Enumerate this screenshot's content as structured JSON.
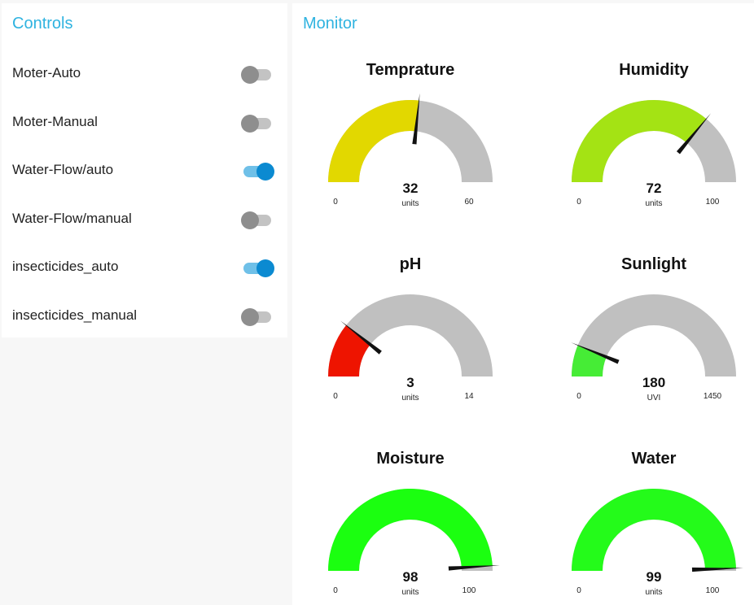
{
  "controls": {
    "title": "Controls",
    "items": [
      {
        "label": "Moter-Auto",
        "on": false
      },
      {
        "label": "Moter-Manual",
        "on": false
      },
      {
        "label": "Water-Flow/auto",
        "on": true
      },
      {
        "label": "Water-Flow/manual",
        "on": false
      },
      {
        "label": "insecticides_auto",
        "on": true
      },
      {
        "label": "insecticides_manual",
        "on": false
      }
    ]
  },
  "monitor": {
    "title": "Monitor",
    "gauges": [
      {
        "title": "Temprature",
        "value": 32,
        "units": "units",
        "min": 0,
        "max": 60,
        "color": "#e2d800"
      },
      {
        "title": "Humidity",
        "value": 72,
        "units": "units",
        "min": 0,
        "max": 100,
        "color": "#a4e314"
      },
      {
        "title": "pH",
        "value": 3,
        "units": "units",
        "min": 0,
        "max": 14,
        "color": "#ee1400"
      },
      {
        "title": "Sunlight",
        "value": 180,
        "units": "UVI",
        "min": 0,
        "max": 1450,
        "color": "#46ec36"
      },
      {
        "title": "Moisture",
        "value": 98,
        "units": "units",
        "min": 0,
        "max": 100,
        "color": "#1bff10"
      },
      {
        "title": "Water",
        "value": 99,
        "units": "units",
        "min": 0,
        "max": 100,
        "color": "#24fb1a"
      }
    ]
  },
  "colors": {
    "accent": "#2fb3e0",
    "toggle_on": "#0b8ad1",
    "gauge_track": "#c0c0c0",
    "needle": "#111111"
  }
}
